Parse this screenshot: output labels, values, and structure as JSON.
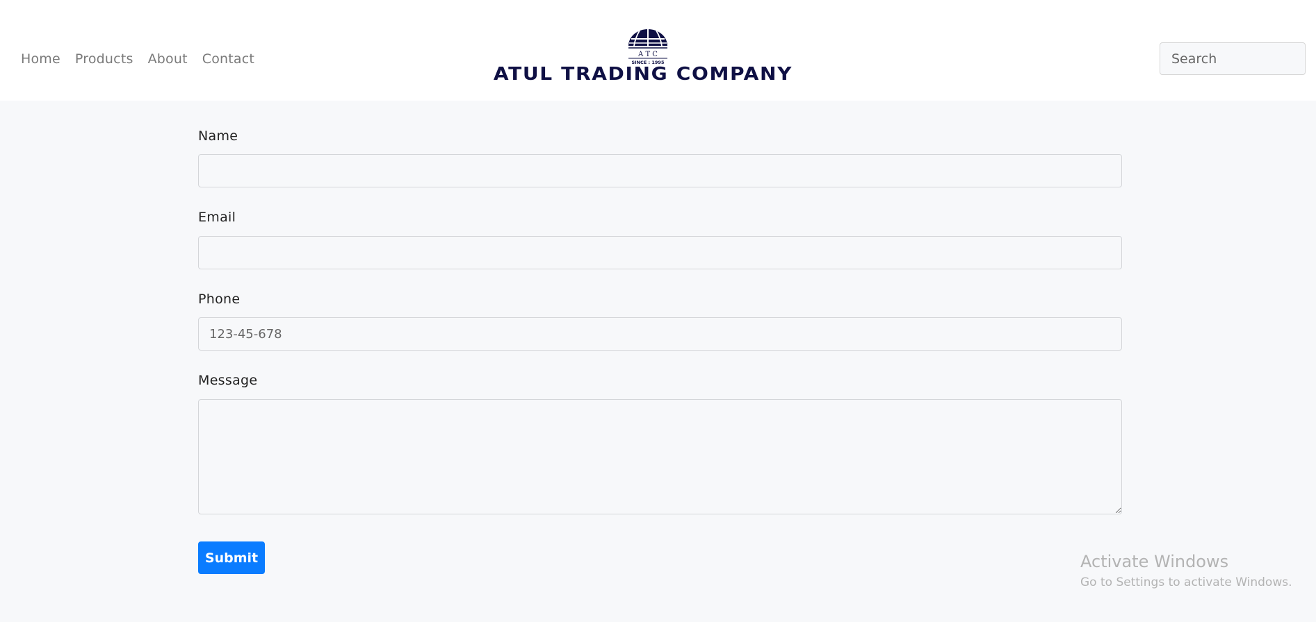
{
  "nav": {
    "items": [
      {
        "label": "Home"
      },
      {
        "label": "Products"
      },
      {
        "label": "About"
      },
      {
        "label": "Contact"
      }
    ]
  },
  "logo": {
    "emblem_letters": "A T C",
    "since": "SINCE : 1995",
    "company_name": "ATUL TRADING COMPANY",
    "color": "#0f1044"
  },
  "search": {
    "placeholder": "Search",
    "value": ""
  },
  "form": {
    "name": {
      "label": "Name",
      "placeholder": "",
      "value": ""
    },
    "email": {
      "label": "Email",
      "placeholder": "",
      "value": ""
    },
    "phone": {
      "label": "Phone",
      "placeholder": "123-45-678",
      "value": ""
    },
    "message": {
      "label": "Message",
      "placeholder": "",
      "value": ""
    },
    "submit_label": "Submit"
  },
  "watermark": {
    "title": "Activate Windows",
    "subtitle": "Go to Settings to activate Windows."
  },
  "colors": {
    "accent": "#0a7cff",
    "background": "#f7f8fa",
    "header_bg": "#ffffff",
    "nav_text": "#7a7a7a"
  }
}
